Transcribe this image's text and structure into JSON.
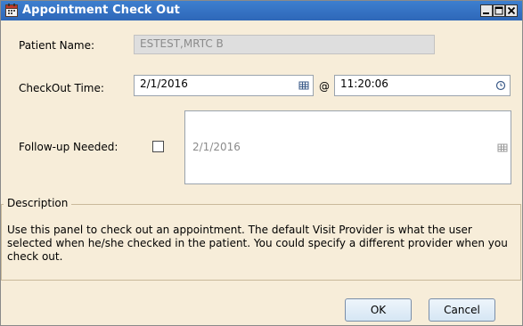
{
  "window": {
    "title": "Appointment Check Out"
  },
  "patient": {
    "label": "Patient Name:",
    "value": "ESTEST,MRTC B"
  },
  "checkout": {
    "label": "CheckOut Time:",
    "date": "2/1/2016",
    "at": "@",
    "time": "11:20:06"
  },
  "followup": {
    "label": "Follow-up Needed:",
    "checked": false,
    "date": "2/1/2016"
  },
  "description": {
    "legend": "Description",
    "text": "Use this panel to check out an appointment. The default Visit Provider is what the user selected when he/she checked in the patient. You could specify a different provider when you check out."
  },
  "buttons": {
    "ok": "OK",
    "cancel": "Cancel"
  },
  "icons": [
    "calendar-window-icon",
    "minimize-icon",
    "maximize-icon",
    "close-icon",
    "calendar-picker-icon",
    "clock-icon"
  ],
  "colors": {
    "titlebar": "#2e67b8",
    "panel": "#f7edd9",
    "disabled": "#dedede"
  }
}
